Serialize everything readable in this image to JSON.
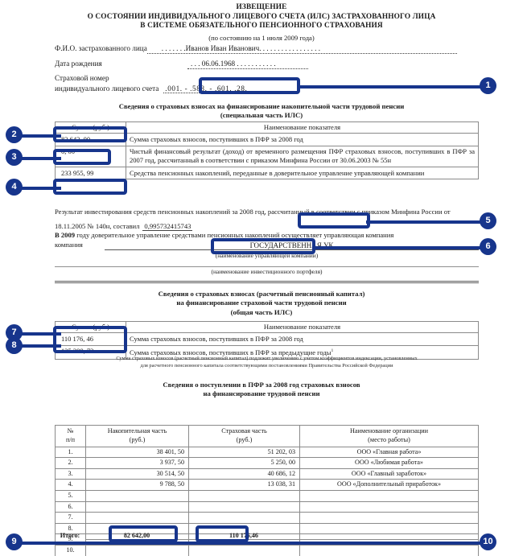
{
  "document": {
    "title_line1": "ИЗВЕЩЕНИЕ",
    "title_line2": "О СОСТОЯНИИ ИНДИВИДУАЛЬНОГО ЛИЦЕВОГО СЧЕТА (ИЛС) ЗАСТРАХОВАННОГО ЛИЦА",
    "title_line3": "В СИСТЕМЕ ОБЯЗАТЕЛЬНОГО ПЕНСИОННОГО СТРАХОВАНИЯ",
    "subtitle": "(по состоянию на 1 июля 2009 года)"
  },
  "person": {
    "fio_label": "Ф.И.О. застрахованного лица",
    "fio_value": ". . . . . . .Иванов Иван Иванович. . . . . . . . . . . . . . . . .",
    "birth_label": "Дата рождения",
    "birth_value": ". . . 06.06.1968 . . . . . . . . . . .",
    "snils_label_line1": "Страховой номер",
    "snils_label_line2": "индивидуального лицевого счета",
    "snils_value": ".001. -  .588. -  .601.  .28."
  },
  "special_part": {
    "heading_line1": "Сведения о страховых взносах на финансирование накопительной части трудовой пенсии",
    "heading_line2": "(специальная часть ИЛС)",
    "col_amount": "Сумма (руб.)",
    "col_name": "Наименование показателя",
    "rows": [
      {
        "amount": "82 642, 00",
        "description": "Сумма страховых взносов, поступивших в ПФР за 2008 год"
      },
      {
        "amount": "0, 00",
        "description": "Чистый финансовый результат (доход) от временного  размещения ПФР страховых взносов, поступивших в  ПФР за 2007 год, рассчитанный в  соответствии с  приказом Минфина России от 30.06.2003 № 55н"
      },
      {
        "amount": "233 955, 99",
        "description": "Средства пенсионных накоплений, переданные в доверительное управление управляющей компании"
      }
    ],
    "invest_text_pre": "Результат инвестирования средств пенсионных накоплений за 2008 год, рассчитанный в  соответствии с приказом Минфина России от 18.11.2005 № 140н, составил",
    "invest_value": "0,995732415743",
    "mgmt_text_pre": "В 2009",
    "mgmt_text_mid": "году доверительное управление средствами пенсионных накоплений осуществляет управляющая компания",
    "mgmt_company": "ГОСУДАРСТВЕННАЯ УК",
    "mgmt_caption": "(наименование управляющей компании)",
    "portfolio_caption": "(наименование инвестиционного портфеля)"
  },
  "common_part": {
    "heading_line1": "Сведения о страховых взносах (расчетный пенсионный капитал)",
    "heading_line2": "на финансирование страховой части трудовой пенсии",
    "heading_line3": "(общая часть ИЛС)",
    "col_amount": "Сумма (руб.)",
    "col_name": "Наименование показателя",
    "rows": [
      {
        "amount": "110 176, 46",
        "description": "Сумма страховых взносов, поступивших в ПФР за 2008 год"
      },
      {
        "amount": "125 388, 73",
        "description": "Сумма страховых взносов, поступивших в ПФР за предыдущие годы",
        "footnote_marker": "1"
      }
    ],
    "footnote_line1": "Сумма страховых взносов (расчетный пенсионный капитал) подлежит увеличению с  учетом коэффициентов индексации, установленных",
    "footnote_line2": "для расчетного пенсионного капитала соответствующими постановлениями Правительства Российской Федерации"
  },
  "registry": {
    "heading_line1": "Сведения о поступлении в ПФР за 2008 год страховых взносов",
    "heading_line2": "на финансирование трудовой пенсии",
    "columns": [
      {
        "line1": "№",
        "line2": "п/п"
      },
      {
        "line1": "Накопительная часть",
        "line2": "(руб.)"
      },
      {
        "line1": "Страховая часть",
        "line2": "(руб.)"
      },
      {
        "line1": "Наименование организации",
        "line2": "(место работы)"
      }
    ],
    "rows": [
      {
        "no": "1.",
        "nakop": "38 401, 50",
        "strah": "51 202, 03",
        "org": "ООО «Главная работа»"
      },
      {
        "no": "2.",
        "nakop": "3 937, 50",
        "strah": "5 250, 00",
        "org": "ООО «Любимая работа»"
      },
      {
        "no": "3.",
        "nakop": "30 514, 50",
        "strah": "40 686, 12",
        "org": "ООО «Главный заработок»"
      },
      {
        "no": "4.",
        "nakop": "9 788, 50",
        "strah": "13 038, 31",
        "org": "ООО «Дополнительный приработок»"
      },
      {
        "no": "5.",
        "nakop": "",
        "strah": "",
        "org": ""
      },
      {
        "no": "6.",
        "nakop": "",
        "strah": "",
        "org": ""
      },
      {
        "no": "7.",
        "nakop": "",
        "strah": "",
        "org": ""
      },
      {
        "no": "8.",
        "nakop": "",
        "strah": "",
        "org": ""
      },
      {
        "no": "9.",
        "nakop": "",
        "strah": "",
        "org": ""
      },
      {
        "no": "10.",
        "nakop": "",
        "strah": "",
        "org": ""
      }
    ],
    "total_label": "Итого:",
    "total_nakop": "82 642,00",
    "total_strah": "110 176,46"
  },
  "callouts": {
    "accent_color": "#17358c",
    "items": [
      {
        "number": "1",
        "target": "snils-value"
      },
      {
        "number": "2",
        "target": "special-row-1-amount"
      },
      {
        "number": "3",
        "target": "special-row-2-amount"
      },
      {
        "number": "4",
        "target": "special-row-3-amount"
      },
      {
        "number": "5",
        "target": "investment-result-value"
      },
      {
        "number": "6",
        "target": "management-company-value"
      },
      {
        "number": "7",
        "target": "common-row-1-amount"
      },
      {
        "number": "8",
        "target": "common-row-2-amount"
      },
      {
        "number": "9",
        "target": "total-nakop-value"
      },
      {
        "number": "10",
        "target": "total-strah-value"
      }
    ]
  }
}
